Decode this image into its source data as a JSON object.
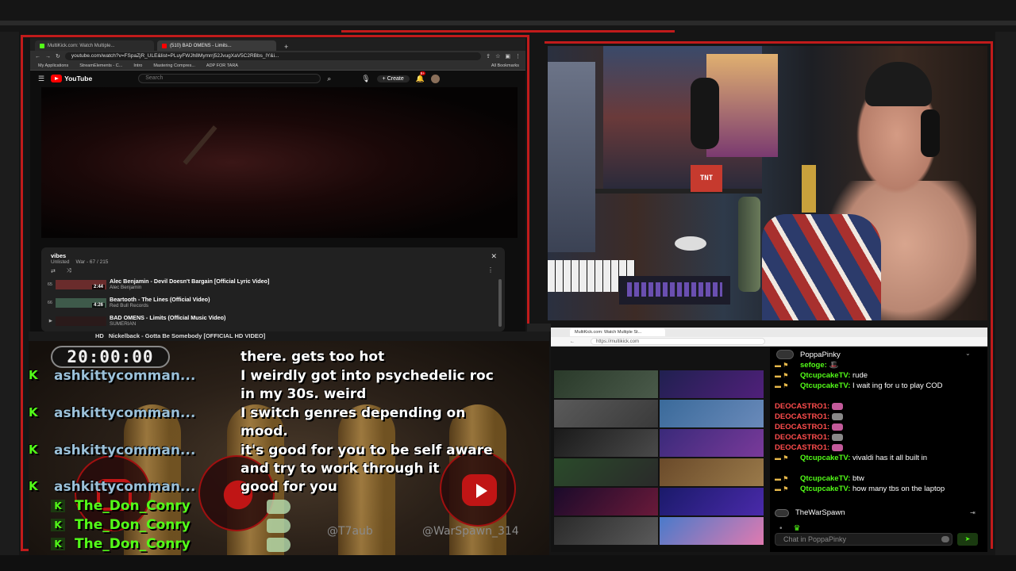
{
  "browser": {
    "tabs": [
      "MultiKick.com: Watch Multiple...",
      "(510) BAD OMENS - Limits..."
    ],
    "url": "youtube.com/watch?v=FSpaZjR_ULE&list=PLuyFWJh8Mymrrj52JvugXaV5C2RBbs_lY&i...",
    "bookmarks": [
      "My Applications",
      "StreamElements - C...",
      "Intro",
      "Mastering Compres...",
      "ADP FOR TARA",
      "All Bookmarks"
    ],
    "youtube": {
      "logo": "YouTube",
      "search_placeholder": "Search",
      "create_label": "Create",
      "notif_count": "9+"
    },
    "playlist": {
      "title": "vibes",
      "visibility": "Unlisted",
      "position": "War - 67 / 215",
      "items": [
        {
          "num": "65",
          "title": "Alec Benjamin - Devil Doesn't Bargain [Official Lyric Video]",
          "artist": "Alec Benjamin",
          "duration": "2:44"
        },
        {
          "num": "66",
          "title": "Beartooth - The Lines (Official Video)",
          "artist": "Red Bull Records",
          "duration": "4:26"
        },
        {
          "num": "",
          "title": "BAD OMENS - Limits (Official Music Video)",
          "artist": "SUMERIAN",
          "duration": ""
        }
      ]
    }
  },
  "cam": {
    "tnt_label": "TNT"
  },
  "overlay": {
    "now_playing_hd": "HD",
    "now_playing": "Nickelback - Gotta Be Somebody [OFFICIAL HD VIDEO]",
    "timer": "20:00:00",
    "chat": [
      {
        "user": "ashkittycomman...",
        "lines": [
          "there. gets too hot",
          "I weirdly got into psychedelic roc",
          "in my 30s. weird"
        ]
      },
      {
        "user": "ashkittycomman...",
        "lines": [
          "I switch genres depending on",
          "mood."
        ]
      },
      {
        "user": "ashkittycomman...",
        "lines": [
          "it's good for you to be self aware",
          "and try to work through it"
        ]
      },
      {
        "user": "ashkittycomman...",
        "lines": [
          "good for you"
        ]
      }
    ],
    "don_user": "The_Don_Conry",
    "handles": [
      "@T7aub",
      "@WarSpawn_314"
    ]
  },
  "multikick": {
    "tab": "MultiKick.com: Watch Multiple St...",
    "url": "https://multikick.com",
    "chat_channel": "PoppaPinky",
    "messages": [
      {
        "name": "sefoge:",
        "text": "",
        "style": "green",
        "emote": "hat"
      },
      {
        "name": "QtcupcakeTV:",
        "text": "rude",
        "style": "green"
      },
      {
        "name": "QtcupcakeTV:",
        "text": "I wait ing for u to play COD",
        "style": "green"
      },
      {
        "name": "DEOCASTRO1:",
        "text": "",
        "style": "red",
        "emote": "pink"
      },
      {
        "name": "DEOCASTRO1:",
        "text": "",
        "style": "red",
        "emote": "gray"
      },
      {
        "name": "DEOCASTRO1:",
        "text": "",
        "style": "red",
        "emote": "pink"
      },
      {
        "name": "DEOCASTRO1:",
        "text": "",
        "style": "red",
        "emote": "gray"
      },
      {
        "name": "DEOCASTRO1:",
        "text": "",
        "style": "red",
        "emote": "pink"
      },
      {
        "name": "QtcupcakeTV:",
        "text": "vivaldi has it all built in",
        "style": "green"
      },
      {
        "name": "QtcupcakeTV:",
        "text": "btw",
        "style": "green"
      },
      {
        "name": "QtcupcakeTV:",
        "text": "how many tbs on the laptop",
        "style": "green"
      }
    ],
    "next_channel": "TheWarSpawn",
    "chat_placeholder": "Chat in PoppaPinky"
  },
  "colors": {
    "kick_green": "#53fc18",
    "frame_red": "#c11b1b",
    "yt_red": "#ff0000"
  }
}
